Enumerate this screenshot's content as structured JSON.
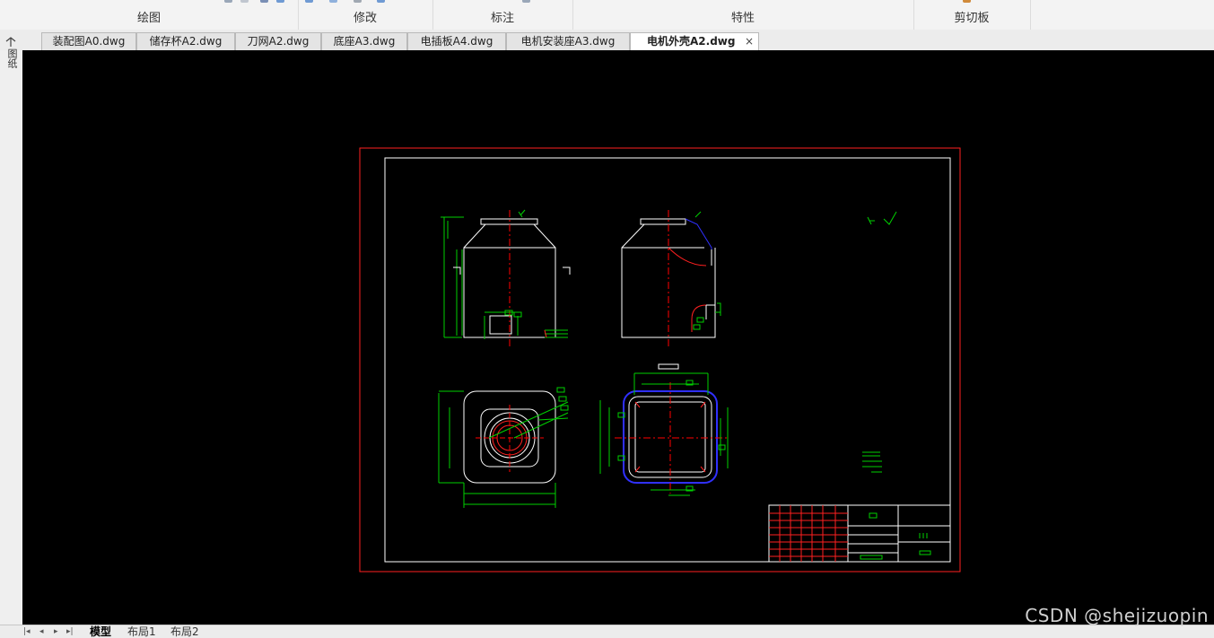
{
  "ribbon": {
    "groups": [
      {
        "label": "绘图"
      },
      {
        "label": "修改"
      },
      {
        "label": "标注"
      },
      {
        "label": "特性"
      },
      {
        "label": "剪切板"
      }
    ]
  },
  "side_panel_label": "图纸",
  "file_tabs": [
    {
      "label": "装配图A0.dwg"
    },
    {
      "label": "储存杯A2.dwg"
    },
    {
      "label": "刀网A2.dwg"
    },
    {
      "label": "底座A3.dwg"
    },
    {
      "label": "电插板A4.dwg"
    },
    {
      "label": "电机安装座A3.dwg"
    },
    {
      "label": "电机外壳A2.dwg",
      "close": "×"
    }
  ],
  "layout_nav": [
    "|◂",
    "◂",
    "▸",
    "▸|"
  ],
  "layout_tabs": [
    {
      "label": "模型"
    },
    {
      "label": "布局1"
    },
    {
      "label": "布局2"
    }
  ],
  "watermark": "CSDN @shejizuopin",
  "colors": {
    "canvas_bg": "#000000",
    "border_red": "#ff2020",
    "frame_white": "#ffffff",
    "dim_green": "#00d000",
    "center_red": "#ff0000",
    "blue": "#3030ff"
  }
}
